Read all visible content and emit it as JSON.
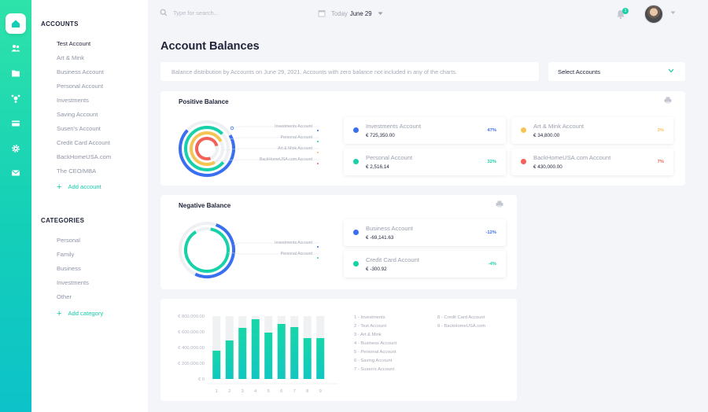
{
  "nav_rail": {
    "items": [
      {
        "icon": "home-icon",
        "active": true
      },
      {
        "icon": "users-icon",
        "active": false
      },
      {
        "icon": "folder-icon",
        "active": false
      },
      {
        "icon": "network-icon",
        "active": false
      },
      {
        "icon": "card-icon",
        "active": false
      },
      {
        "icon": "gear-icon",
        "active": false
      },
      {
        "icon": "mail-icon",
        "active": false
      }
    ]
  },
  "sidebar": {
    "accounts_title": "ACCOUNTS",
    "accounts": [
      "Test Account",
      "Art & Mink",
      "Business Account",
      "Personal Account",
      "Investments",
      "Saving Account",
      "Susen's Account",
      "Credit Card Account",
      "BackHomeUSA.com",
      "The CEO/MBA"
    ],
    "active_account": "Test Account",
    "add_account": "Add account",
    "categories_title": "CATEGORIES",
    "categories": [
      "Personal",
      "Family",
      "Business",
      "Investments",
      "Other"
    ],
    "add_category": "Add category"
  },
  "topbar": {
    "search_placeholder": "Type for search...",
    "today_label": "Today",
    "date": "June 29",
    "notification_count": "1"
  },
  "page": {
    "title": "Account Balances",
    "info": "Balance distribution by Accounts on June 29, 2021. Accounts with zero balance  not included in any of the charts.",
    "select_label": "Select Accounts"
  },
  "positive": {
    "title": "Positive Balance",
    "legend": [
      "Investments Account",
      "Personal Account",
      "Art & Mink Account",
      "BackHomeUSA.com Account"
    ],
    "stats": [
      {
        "name": "Investments Account",
        "value": "€ 725,350.00",
        "pct": "47%",
        "color": "#3a6ff0"
      },
      {
        "name": "Art & Mink Account",
        "value": "€ 34,800.00",
        "pct": "3%",
        "color": "#f5c453"
      },
      {
        "name": "Personal Account",
        "value": "€ 2,516,14",
        "pct": "32%",
        "color": "#17d1a9"
      },
      {
        "name": "BackHomeUSA.com Account",
        "value": "€ 430,000.00",
        "pct": "7%",
        "color": "#f2625a"
      }
    ]
  },
  "negative": {
    "title": "Negative Balance",
    "legend": [
      "Investments Account",
      "Personal Account"
    ],
    "stats": [
      {
        "name": "Business Account",
        "value": "€ -69,141.63",
        "pct": "-12%",
        "color": "#3a6ff0"
      },
      {
        "name": "Credit Card Account",
        "value": "€ -300.92",
        "pct": "-4%",
        "color": "#17d1a9"
      }
    ]
  },
  "chart_data": {
    "type": "bar",
    "categories": [
      "1",
      "2",
      "3",
      "4",
      "5",
      "6",
      "7",
      "8",
      "9"
    ],
    "values": [
      360000,
      490000,
      650000,
      760000,
      590000,
      700000,
      660000,
      520000,
      520000
    ],
    "ylim": [
      0,
      800000
    ],
    "yticks": [
      "€ 800,000.00",
      "€ 600,000.00",
      "€ 400,000.00",
      "€ 200,000.00",
      "€ 0"
    ],
    "legend": [
      "1 - Investments",
      "2 - Test Account",
      "3 - Art & Mink",
      "4 - Business Account",
      "5 - Personal Account",
      "6 - Saving Account",
      "7 - Susen's Account",
      "8 - Credit Card Account",
      "9 - BackHomeUSA.com"
    ],
    "colors": {
      "bar_top": "#17d6a8",
      "bar_bottom": "#12c7c0",
      "track": "#f0f1f3"
    }
  }
}
